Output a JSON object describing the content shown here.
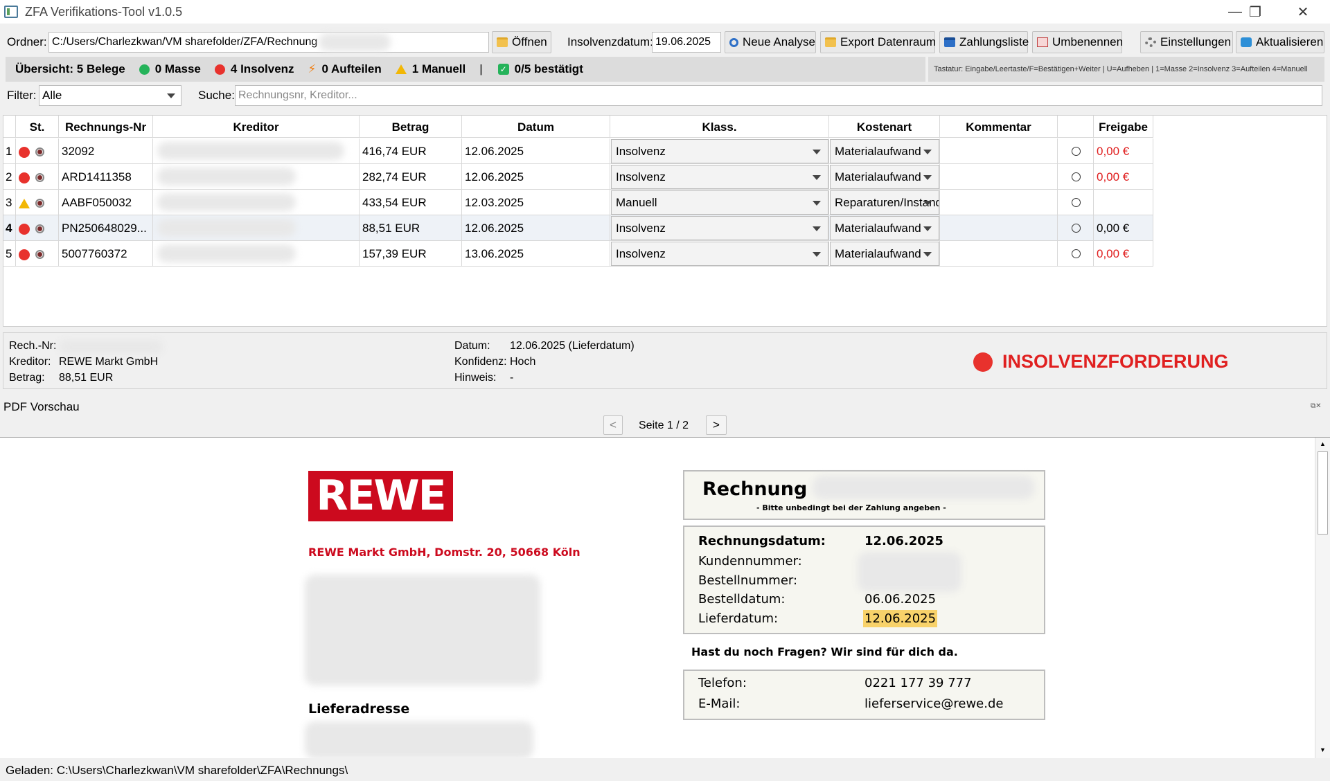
{
  "window": {
    "title": "ZFA Verifikations-Tool v1.0.5",
    "minimize": "—",
    "maximize": "❐",
    "close": "✕"
  },
  "toolbar": {
    "ordner_label": "Ordner:",
    "ordner_value": "C:/Users/Charlezkwan/VM sharefolder/ZFA/Rechnung",
    "open_label": "Öffnen",
    "insolvenz_label": "Insolvenzdatum:",
    "insolvenz_value": "19.06.2025",
    "neue_analyse": "Neue Analyse",
    "export": "Export Datenraum",
    "zahlungsliste": "Zahlungsliste",
    "umbenennen": "Umbenennen",
    "einstellungen": "Einstellungen",
    "aktualisieren": "Aktualisieren"
  },
  "summary": {
    "overview": "Übersicht: 5 Belege",
    "masse": "0 Masse",
    "insolvenz": "4 Insolvenz",
    "aufteilen": "0 Aufteilen",
    "manuell": "1 Manuell",
    "separator": "|",
    "bestaetigt": "0/5 bestätigt",
    "colors": {
      "masse": "#25b35a",
      "insolvenz": "#e8322d"
    },
    "keyboard_hint": "Tastatur: Eingabe/Leertaste/F=Bestätigen+Weiter | U=Aufheben | 1=Masse 2=Insolvenz 3=Aufteilen 4=Manuell"
  },
  "filter": {
    "filter_label": "Filter:",
    "filter_value": "Alle",
    "search_label": "Suche:",
    "search_placeholder": "Rechnungsnr, Kreditor..."
  },
  "table": {
    "headers": {
      "st": "St.",
      "nr": "Rechnungs-Nr",
      "kreditor": "Kreditor",
      "betrag": "Betrag",
      "datum": "Datum",
      "klass": "Klass.",
      "kostenart": "Kostenart",
      "kommentar": "Kommentar",
      "freigabe": "Freigabe"
    },
    "rows": [
      {
        "idx": "1",
        "status": "insolvenz",
        "nr": "32092",
        "betrag": "416,74 EUR",
        "datum": "12.06.2025",
        "klass": "Insolvenz",
        "kostenart": "Materialaufwand",
        "freigabe": "0,00 €",
        "freigabe_red": true
      },
      {
        "idx": "2",
        "status": "insolvenz",
        "nr": "ARD1411358",
        "betrag": "282,74 EUR",
        "datum": "12.06.2025",
        "klass": "Insolvenz",
        "kostenart": "Materialaufwand",
        "freigabe": "0,00 €",
        "freigabe_red": true
      },
      {
        "idx": "3",
        "status": "manuell",
        "nr": "AABF050032",
        "betrag": "433,54 EUR",
        "datum": "12.03.2025",
        "klass": "Manuell",
        "kostenart": "Reparaturen/Instandhaltung",
        "freigabe": "",
        "freigabe_red": false
      },
      {
        "idx": "4",
        "status": "insolvenz",
        "nr": "PN250648029...",
        "betrag": "88,51 EUR",
        "datum": "12.06.2025",
        "klass": "Insolvenz",
        "kostenart": "Materialaufwand",
        "freigabe": "0,00 €",
        "freigabe_red": false
      },
      {
        "idx": "5",
        "status": "insolvenz",
        "nr": "5007760372",
        "betrag": "157,39 EUR",
        "datum": "13.06.2025",
        "klass": "Insolvenz",
        "kostenart": "Materialaufwand",
        "freigabe": "0,00 €",
        "freigabe_red": true
      }
    ]
  },
  "detail": {
    "rech_label": "Rech.-Nr:",
    "kreditor_label": "Kreditor:",
    "kreditor_value": "REWE Markt GmbH",
    "betrag_label": "Betrag:",
    "betrag_value": "88,51 EUR",
    "datum_label": "Datum:",
    "datum_value": "12.06.2025 (Lieferdatum)",
    "konfidenz_label": "Konfidenz:",
    "konfidenz_value": "Hoch",
    "hinweis_label": "Hinweis:",
    "hinweis_value": "-",
    "verdict": "INSOLVENZFORDERUNG"
  },
  "pdf": {
    "title": "PDF Vorschau",
    "prev": "<",
    "next": ">",
    "page": "Seite 1 / 2",
    "logo": "REWE",
    "sender": "REWE Markt GmbH, Domstr. 20, 50668 Köln",
    "rechnung": "Rechnung",
    "rechnung_note": "- Bitte unbedingt bei der Zahlung angeben -",
    "rechnungsdatum_label": "Rechnungsdatum:",
    "rechnungsdatum_value": "12.06.2025",
    "kundennummer_label": "Kundennummer:",
    "bestellnummer_label": "Bestellnummer:",
    "bestelldatum_label": "Bestelldatum:",
    "bestelldatum_value": "06.06.2025",
    "lieferdatum_label": "Lieferdatum:",
    "lieferdatum_value": "12.06.2025",
    "fragen": "Hast du noch Fragen? Wir sind für dich da.",
    "telefon_label": "Telefon:",
    "telefon_value": "0221 177 39 777",
    "email_label": "E-Mail:",
    "email_value": "lieferservice@rewe.de",
    "lieferadresse": "Lieferadresse",
    "highlight_color": "#f8d26a",
    "brand_color": "#cc0a1e"
  },
  "status": {
    "text": "Geladen: C:\\Users\\Charlezkwan\\VM sharefolder\\ZFA\\Rechnungs\\"
  }
}
